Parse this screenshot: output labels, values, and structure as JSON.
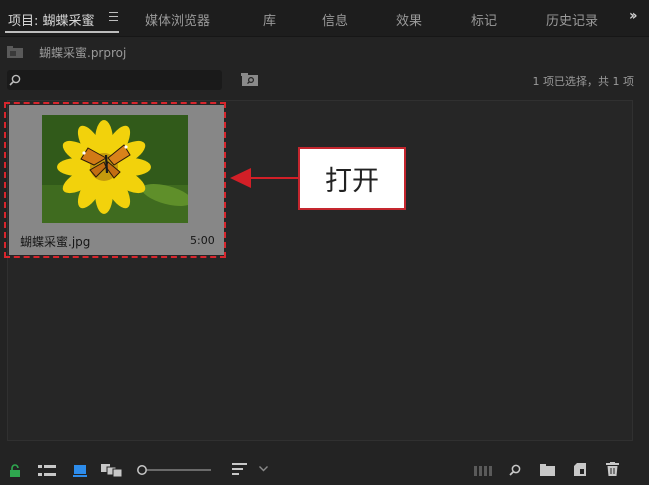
{
  "tabs": [
    {
      "label": "项目: 蝴蝶采蜜"
    },
    {
      "label": "媒体浏览器"
    },
    {
      "label": "库"
    },
    {
      "label": "信息"
    },
    {
      "label": "效果"
    },
    {
      "label": "标记"
    },
    {
      "label": "历史记录"
    }
  ],
  "project": {
    "file_name": "蝴蝶采蜜.prproj"
  },
  "search": {
    "placeholder": ""
  },
  "selection_info": "1 项已选择，共 1 项",
  "items": [
    {
      "name": "蝴蝶采蜜.jpg",
      "duration": "5:00"
    }
  ],
  "callout": {
    "text": "打开"
  },
  "colors": {
    "annotation_red": "#d21f27",
    "active_tab": "#d8d8d8",
    "lock_green": "#2fa84f",
    "list_blue": "#2d8ceb"
  },
  "icons": {
    "tab_menu": "hamburger-icon",
    "overflow": "double-chevron-right-icon",
    "project": "folder-icon",
    "search": "search-icon",
    "find": "find-icon",
    "bottom": [
      "lock-icon",
      "list-view-icon",
      "icon-view-icon",
      "freeform-view-icon",
      "zoom-slider",
      "sort-icon",
      "chevron-down-icon",
      "automate-icon",
      "find-icon",
      "new-bin-icon",
      "new-item-icon",
      "trash-icon"
    ]
  }
}
